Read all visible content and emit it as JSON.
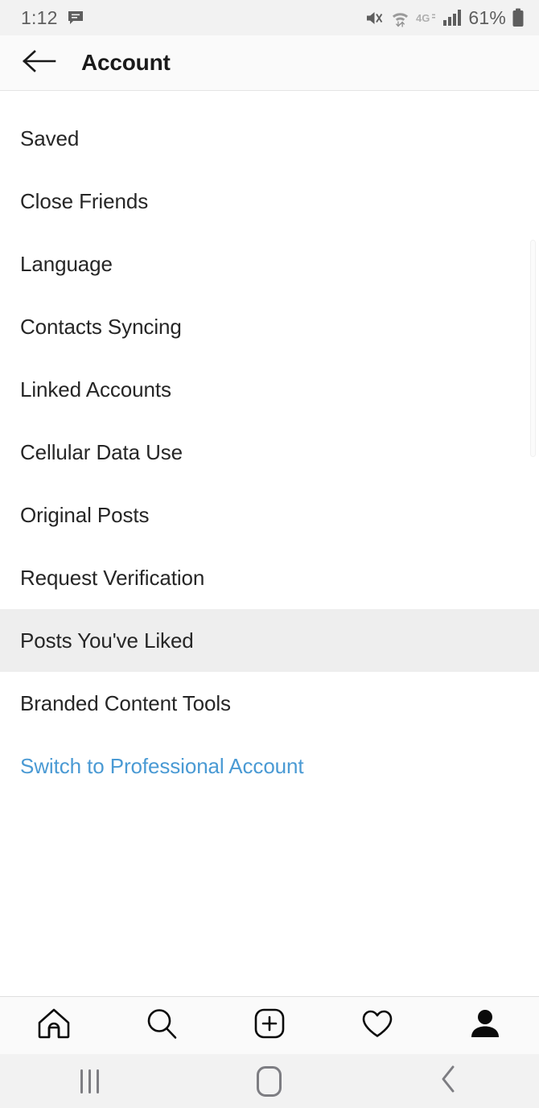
{
  "status_bar": {
    "time": "1:12",
    "message_icon": "message-bubble-icon",
    "mute_icon": "volume-mute-vibrate-icon",
    "wifi_icon": "wifi-data-transfer-icon",
    "network_label": "4G",
    "signal_icon": "cellular-signal-icon",
    "battery_percent": "61%",
    "battery_icon": "battery-icon",
    "text_color": "#5e5e5e",
    "background": "#f2f2f2"
  },
  "header": {
    "back_icon": "back-arrow-icon",
    "title": "Account",
    "background": "#fafafa"
  },
  "settings_list": {
    "items": [
      {
        "label": "Saved",
        "state": "normal"
      },
      {
        "label": "Close Friends",
        "state": "normal"
      },
      {
        "label": "Language",
        "state": "normal"
      },
      {
        "label": "Contacts Syncing",
        "state": "normal"
      },
      {
        "label": "Linked Accounts",
        "state": "normal"
      },
      {
        "label": "Cellular Data Use",
        "state": "normal"
      },
      {
        "label": "Original Posts",
        "state": "normal"
      },
      {
        "label": "Request Verification",
        "state": "normal"
      },
      {
        "label": "Posts You've Liked",
        "state": "pressed"
      },
      {
        "label": "Branded Content Tools",
        "state": "normal"
      },
      {
        "label": "Switch to Professional Account",
        "state": "link"
      }
    ],
    "pressed_background": "#eeeeee",
    "link_color": "#4a9ad4",
    "text_color": "#262626",
    "scrollbar": "vertical-scrollbar"
  },
  "tab_bar": {
    "tabs": [
      {
        "name": "home-tab",
        "icon": "home-icon",
        "active": false
      },
      {
        "name": "search-tab",
        "icon": "search-icon",
        "active": false
      },
      {
        "name": "create-tab",
        "icon": "add-post-icon",
        "active": false
      },
      {
        "name": "activity-tab",
        "icon": "heart-icon",
        "active": false
      },
      {
        "name": "profile-tab",
        "icon": "person-filled-icon",
        "active": true
      }
    ],
    "background": "#fafafa"
  },
  "nav_bar": {
    "buttons": [
      {
        "name": "recents-button",
        "icon": "recents-icon"
      },
      {
        "name": "home-button",
        "icon": "home-squircle-icon"
      },
      {
        "name": "back-button",
        "icon": "chevron-left-icon"
      }
    ],
    "background": "#f2f2f2",
    "glyph_color": "#7d7d82"
  }
}
